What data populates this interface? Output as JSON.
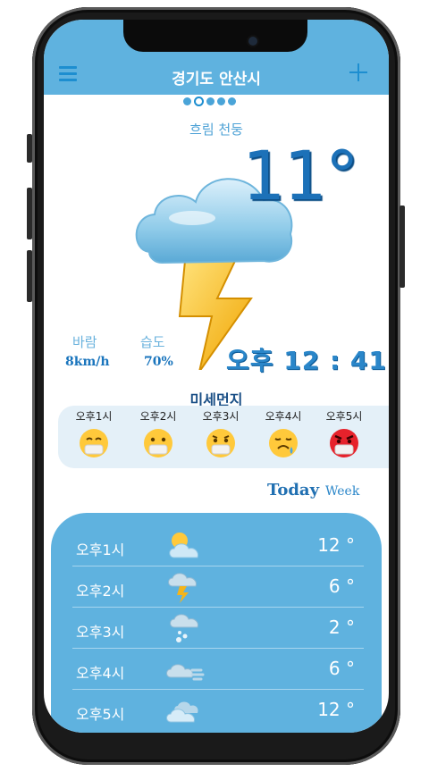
{
  "header": {
    "title": "경기도 안산시"
  },
  "current": {
    "condition": "흐림 천둥",
    "temperature": "11°",
    "wind_label": "바람",
    "wind_value": "8km/h",
    "humidity_label": "습도",
    "humidity_value": "70%",
    "time": "오후 12 : 41",
    "icon": "cloud-lightning-icon"
  },
  "pagination": {
    "count": 5,
    "active_index": 1
  },
  "dust": {
    "title": "미세먼지",
    "items": [
      {
        "time": "오후1시",
        "icon": "good-face-icon"
      },
      {
        "time": "오후2시",
        "icon": "normal-face-icon"
      },
      {
        "time": "오후3시",
        "icon": "worried-face-icon"
      },
      {
        "time": "오후4시",
        "icon": "sad-face-icon"
      },
      {
        "time": "오후5시",
        "icon": "angry-face-icon"
      }
    ]
  },
  "tabs": {
    "today": "Today",
    "week": "Week"
  },
  "hourly": [
    {
      "time": "오후1시",
      "temp": "12 °",
      "icon": "sun-cloud-icon"
    },
    {
      "time": "오후2시",
      "temp": "6 °",
      "icon": "cloud-lightning-icon"
    },
    {
      "time": "오후3시",
      "temp": "2 °",
      "icon": "cloud-snow-icon"
    },
    {
      "time": "오후4시",
      "temp": "6 °",
      "icon": "cloud-wind-icon"
    },
    {
      "time": "오후5시",
      "temp": "12 °",
      "icon": "cloudy-icon"
    }
  ],
  "colors": {
    "primary": "#5fb2df",
    "accent": "#1d8ed0",
    "temperature": "#1c71b8",
    "lightning": "#f4b41a"
  }
}
